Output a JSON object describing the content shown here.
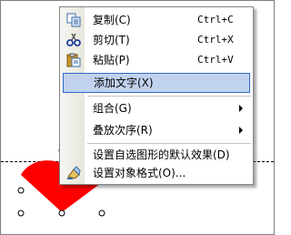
{
  "document": {
    "shape_color": "#ff0000",
    "guide_line": "dashed"
  },
  "context_menu": {
    "items": [
      {
        "label": "复制(C)",
        "shortcut": "Ctrl+C",
        "icon": "copy-icon"
      },
      {
        "label": "剪切(T)",
        "shortcut": "Ctrl+X",
        "icon": "scissors-icon"
      },
      {
        "label": "粘贴(P)",
        "shortcut": "Ctrl+V",
        "icon": "clipboard-paste-icon"
      },
      {
        "label": "添加文字(X)",
        "highlighted": true
      },
      {
        "label": "组合(G)",
        "submenu": true
      },
      {
        "label": "叠放次序(R)",
        "submenu": true
      },
      {
        "label": "设置自选图形的默认效果(D)"
      },
      {
        "label": "设置对象格式(O)...",
        "icon": "format-object-icon"
      }
    ]
  },
  "colors": {
    "highlight_bg": "#c1d2ee",
    "highlight_border": "#316ac5",
    "menu_border": "#868686"
  }
}
